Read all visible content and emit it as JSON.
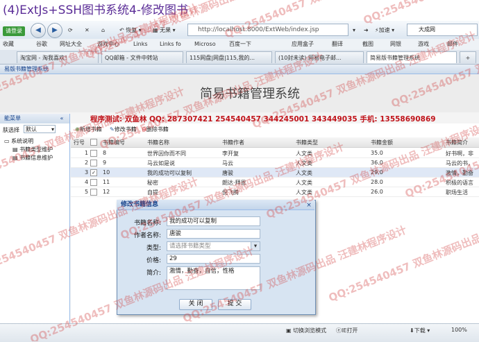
{
  "page_title": "(4)ExtJs+SSH图书系统4-修改图书",
  "browser": {
    "login_label": "请登录",
    "favorites_label": "收藏",
    "restore_label": "恢复",
    "tools_label": "无果",
    "url": "http://localhost:8000/ExtWeb/index.jsp",
    "accelerate_label": "加速",
    "search_placeholder": "大成网",
    "bookmarks": [
      "收藏",
      "谷歌",
      "网址大全",
      "游戏中心",
      "Links",
      "Links fo",
      "Microso",
      "百度一下",
      "应用盒子",
      "翻译",
      "截图",
      "网银",
      "游戏",
      "邮件"
    ],
    "tabs": [
      "淘宝网 - 淘我喜欢！",
      "QQ邮箱 - 文件中转站",
      "115网盘|网盘|115,我的...",
      "(10封未读) 网易电子邮...",
      "简易版书籍管理系统"
    ],
    "new_tab_label": "+"
  },
  "app": {
    "header": "易版书籍管理系统",
    "system_title": "简易书籍管理系统",
    "contact": "程序测试: 双鱼林    QQ: 287307421  254540457  344245001 343449035    手机: 13558690869"
  },
  "left_panel": {
    "title": "能菜单",
    "collapse": "«",
    "skin_label": "肤选择",
    "skin_value": "默认",
    "tree": [
      "系统说明",
      "书籍类型维护",
      "书籍信息维护"
    ]
  },
  "grid": {
    "toolbar": [
      "新增书籍",
      "修改书籍",
      "删除书籍"
    ],
    "columns": [
      "行号",
      "书籍编号",
      "书籍名称",
      "书籍作者",
      "书籍类型",
      "书籍金额",
      "书籍简介"
    ],
    "rows": [
      {
        "no": "1",
        "id": "8",
        "name": "世界因你而不同",
        "author": "李开复",
        "type": "人文类",
        "price": "35.0",
        "intro": "好书啊，非"
      },
      {
        "no": "2",
        "id": "9",
        "name": "马云如是说",
        "author": "马云",
        "type": "人文类",
        "price": "36.0",
        "intro": "马云的书，"
      },
      {
        "no": "3",
        "id": "10",
        "name": "我的成功可以复制",
        "author": "唐骏",
        "type": "人文类",
        "price": "29.0",
        "intro": "激情，勤奋"
      },
      {
        "no": "4",
        "id": "11",
        "name": "秘密",
        "author": "朗达·拜恩",
        "type": "人文类",
        "price": "28.0",
        "intro": "积极的语言"
      },
      {
        "no": "5",
        "id": "12",
        "name": "自提",
        "author": "倪飞腾",
        "type": "人文类",
        "price": "26.0",
        "intro": "职场生活"
      }
    ]
  },
  "dialog": {
    "title": "修改书籍信息",
    "close": "×",
    "fields": [
      {
        "label": "书籍名称:",
        "value": "我的成功可以复制"
      },
      {
        "label": "作者名称:",
        "value": "唐骏"
      },
      {
        "label": "类型:",
        "value": "",
        "placeholder": "请选择书籍类型"
      },
      {
        "label": "价格:",
        "value": "29"
      },
      {
        "label": "简介:",
        "value": "激情，勤奋，自信，性格"
      }
    ],
    "close_button": "关 闭",
    "submit_button": "提 交"
  },
  "status_bar": {
    "browse_mode": "切换浏览模式",
    "ie_open": "IE打开",
    "download": "下载",
    "zoom": "100%"
  },
  "watermark": {
    "text": "QQ:254540457 双鱼林源码出品 汪建林程序设计",
    "color": "#d24646"
  }
}
